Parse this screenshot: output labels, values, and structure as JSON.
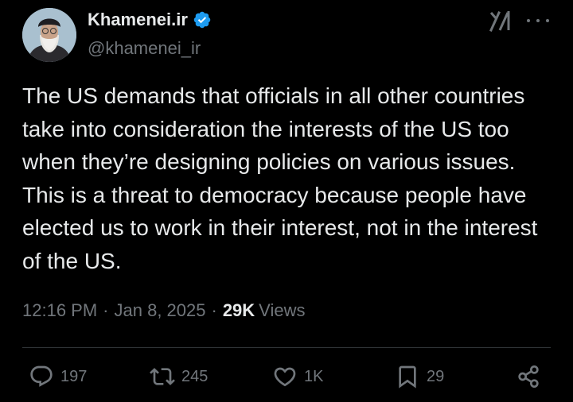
{
  "author": {
    "display_name": "Khamenei.ir",
    "handle": "@khamenei_ir",
    "verified": true,
    "avatar_icon": "profile-photo"
  },
  "header_icons": {
    "grok": "grok-icon",
    "more": "more-options-icon"
  },
  "tweet": {
    "text": "The US demands that officials in all other countries take into consideration the interests of the US too when they’re designing policies on various issues. This is a threat to democracy because people have elected us to work in their interest, not in the interest of the US."
  },
  "meta": {
    "time": "12:16 PM",
    "separator": "·",
    "date": "Jan 8, 2025",
    "views_count": "29K",
    "views_label": "Views"
  },
  "actions": {
    "replies": "197",
    "reposts": "245",
    "likes": "1K",
    "bookmarks": "29"
  },
  "colors": {
    "background": "#000000",
    "text_primary": "#e7e9ea",
    "text_secondary": "#71767b",
    "verified": "#1d9bf0",
    "divider": "#2f3336"
  }
}
